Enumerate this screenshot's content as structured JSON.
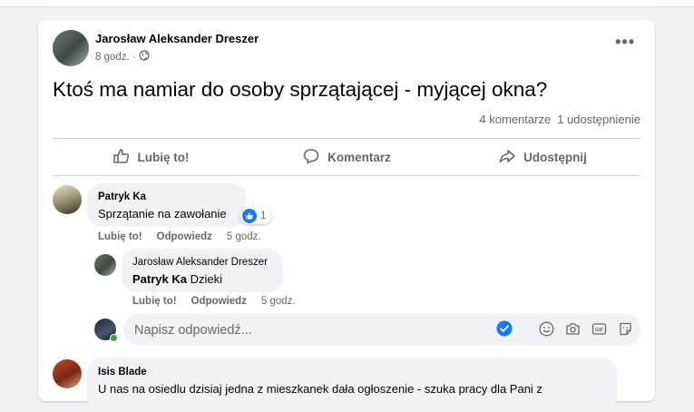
{
  "post": {
    "author": "Jarosław Aleksander Dreszer",
    "time": "8 godz. ·",
    "text": "Ktoś ma namiar do osoby sprzątającej - myjącej okna?",
    "comments_count": "4 komentarze",
    "shares_count": "1 udostępnienie"
  },
  "actions": {
    "like": "Lubię to!",
    "comment": "Komentarz",
    "share": "Udostępnij"
  },
  "comments": [
    {
      "author": "Patryk Ka",
      "text": "Sprzątanie na zawołanie",
      "reactions": "1",
      "like": "Lubię to!",
      "reply": "Odpowiedz",
      "time": "5 godz."
    },
    {
      "author": "Jarosław Aleksander Dreszer",
      "mention": "Patryk Ka",
      "text": "Dzieki",
      "like": "Lubię to!",
      "reply": "Odpowiedz",
      "time": "5 godz."
    },
    {
      "author": "Isis Blade",
      "text": "U nas na osiedlu dzisiaj jedna z mieszkanek dała ogłoszenie - szuka pracy dla Pani z"
    }
  ],
  "reply_input": {
    "placeholder": "Napisz odpowiedź..."
  },
  "colors": {
    "accent": "#1877f2",
    "muted": "#65676b",
    "bubble": "#f0f2f5"
  },
  "icons": [
    "more-icon",
    "globe-icon",
    "like-icon",
    "comment-icon",
    "share-icon",
    "send-icon",
    "emoji-icon",
    "camera-icon",
    "gif-icon",
    "sticker-icon"
  ]
}
